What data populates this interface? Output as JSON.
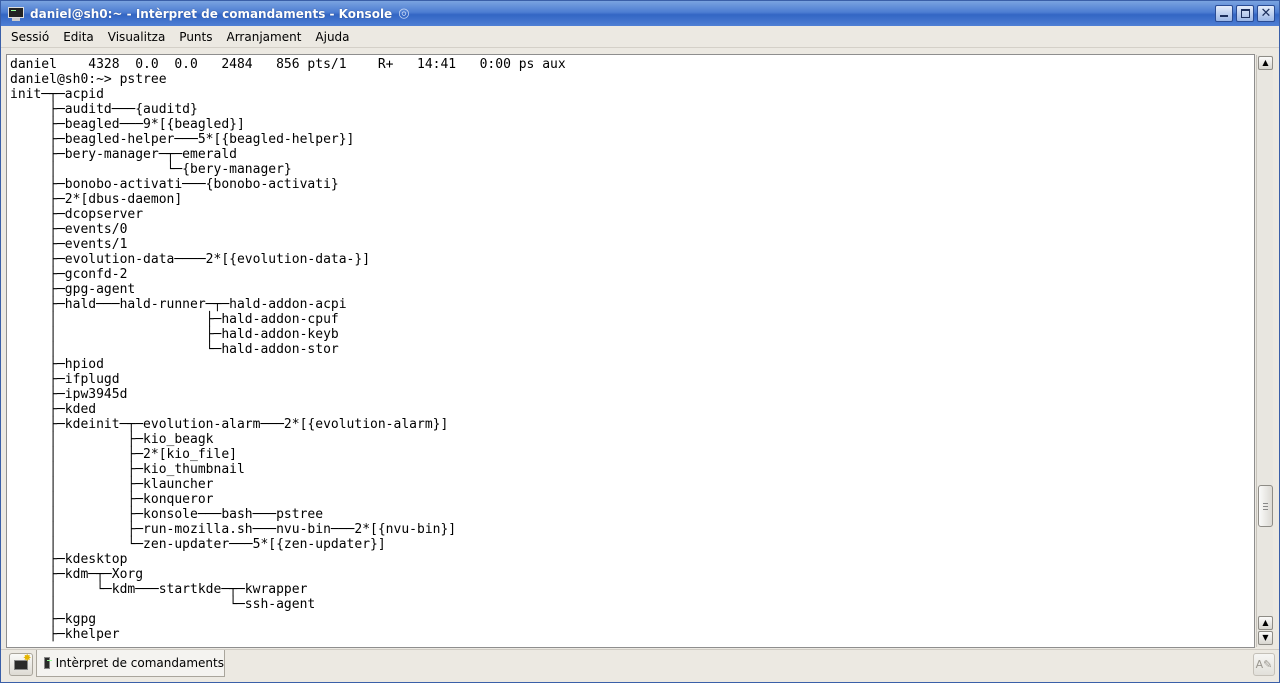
{
  "window": {
    "title": "daniel@sh0:~ - Intèrpret de comandaments - Konsole",
    "icons": {
      "app": "konsole-terminal-icon",
      "desktop": "kde-swirl-icon"
    }
  },
  "menubar": {
    "items": [
      "Sessió",
      "Edita",
      "Visualitza",
      "Punts",
      "Arranjament",
      "Ajuda"
    ]
  },
  "terminal": {
    "lines": [
      "daniel    4328  0.0  0.0   2484   856 pts/1    R+   14:41   0:00 ps aux",
      "daniel@sh0:~> pstree",
      "init─┬─acpid",
      "     ├─auditd───{auditd}",
      "     ├─beagled───9*[{beagled}]",
      "     ├─beagled-helper───5*[{beagled-helper}]",
      "     ├─bery-manager─┬─emerald",
      "     │              └─{bery-manager}",
      "     ├─bonobo-activati───{bonobo-activati}",
      "     ├─2*[dbus-daemon]",
      "     ├─dcopserver",
      "     ├─events/0",
      "     ├─events/1",
      "     ├─evolution-data────2*[{evolution-data-}]",
      "     ├─gconfd-2",
      "     ├─gpg-agent",
      "     ├─hald───hald-runner─┬─hald-addon-acpi",
      "     │                   ├─hald-addon-cpuf",
      "     │                   ├─hald-addon-keyb",
      "     │                   └─hald-addon-stor",
      "     ├─hpiod",
      "     ├─ifplugd",
      "     ├─ipw3945d",
      "     ├─kded",
      "     ├─kdeinit─┬─evolution-alarm───2*[{evolution-alarm}]",
      "     │         ├─kio_beagk",
      "     │         ├─2*[kio_file]",
      "     │         ├─kio_thumbnail",
      "     │         ├─klauncher",
      "     │         ├─konqueror",
      "     │         ├─konsole───bash───pstree",
      "     │         ├─run-mozilla.sh───nvu-bin───2*[{nvu-bin}]",
      "     │         └─zen-updater───5*[{zen-updater}]",
      "     ├─kdesktop",
      "     ├─kdm─┬─Xorg",
      "     │     └─kdm───startkde─┬─kwrapper",
      "     │                      └─ssh-agent",
      "     ├─kgpg",
      "     ├─khelper"
    ]
  },
  "scrollbar": {
    "up": "▲",
    "down": "▼",
    "position": 0.86
  },
  "statusbar": {
    "session_tab_label": "Intèrpret de comandaments",
    "new_session_icon": "new-session-icon",
    "rename_icon": "rename-session-icon"
  }
}
